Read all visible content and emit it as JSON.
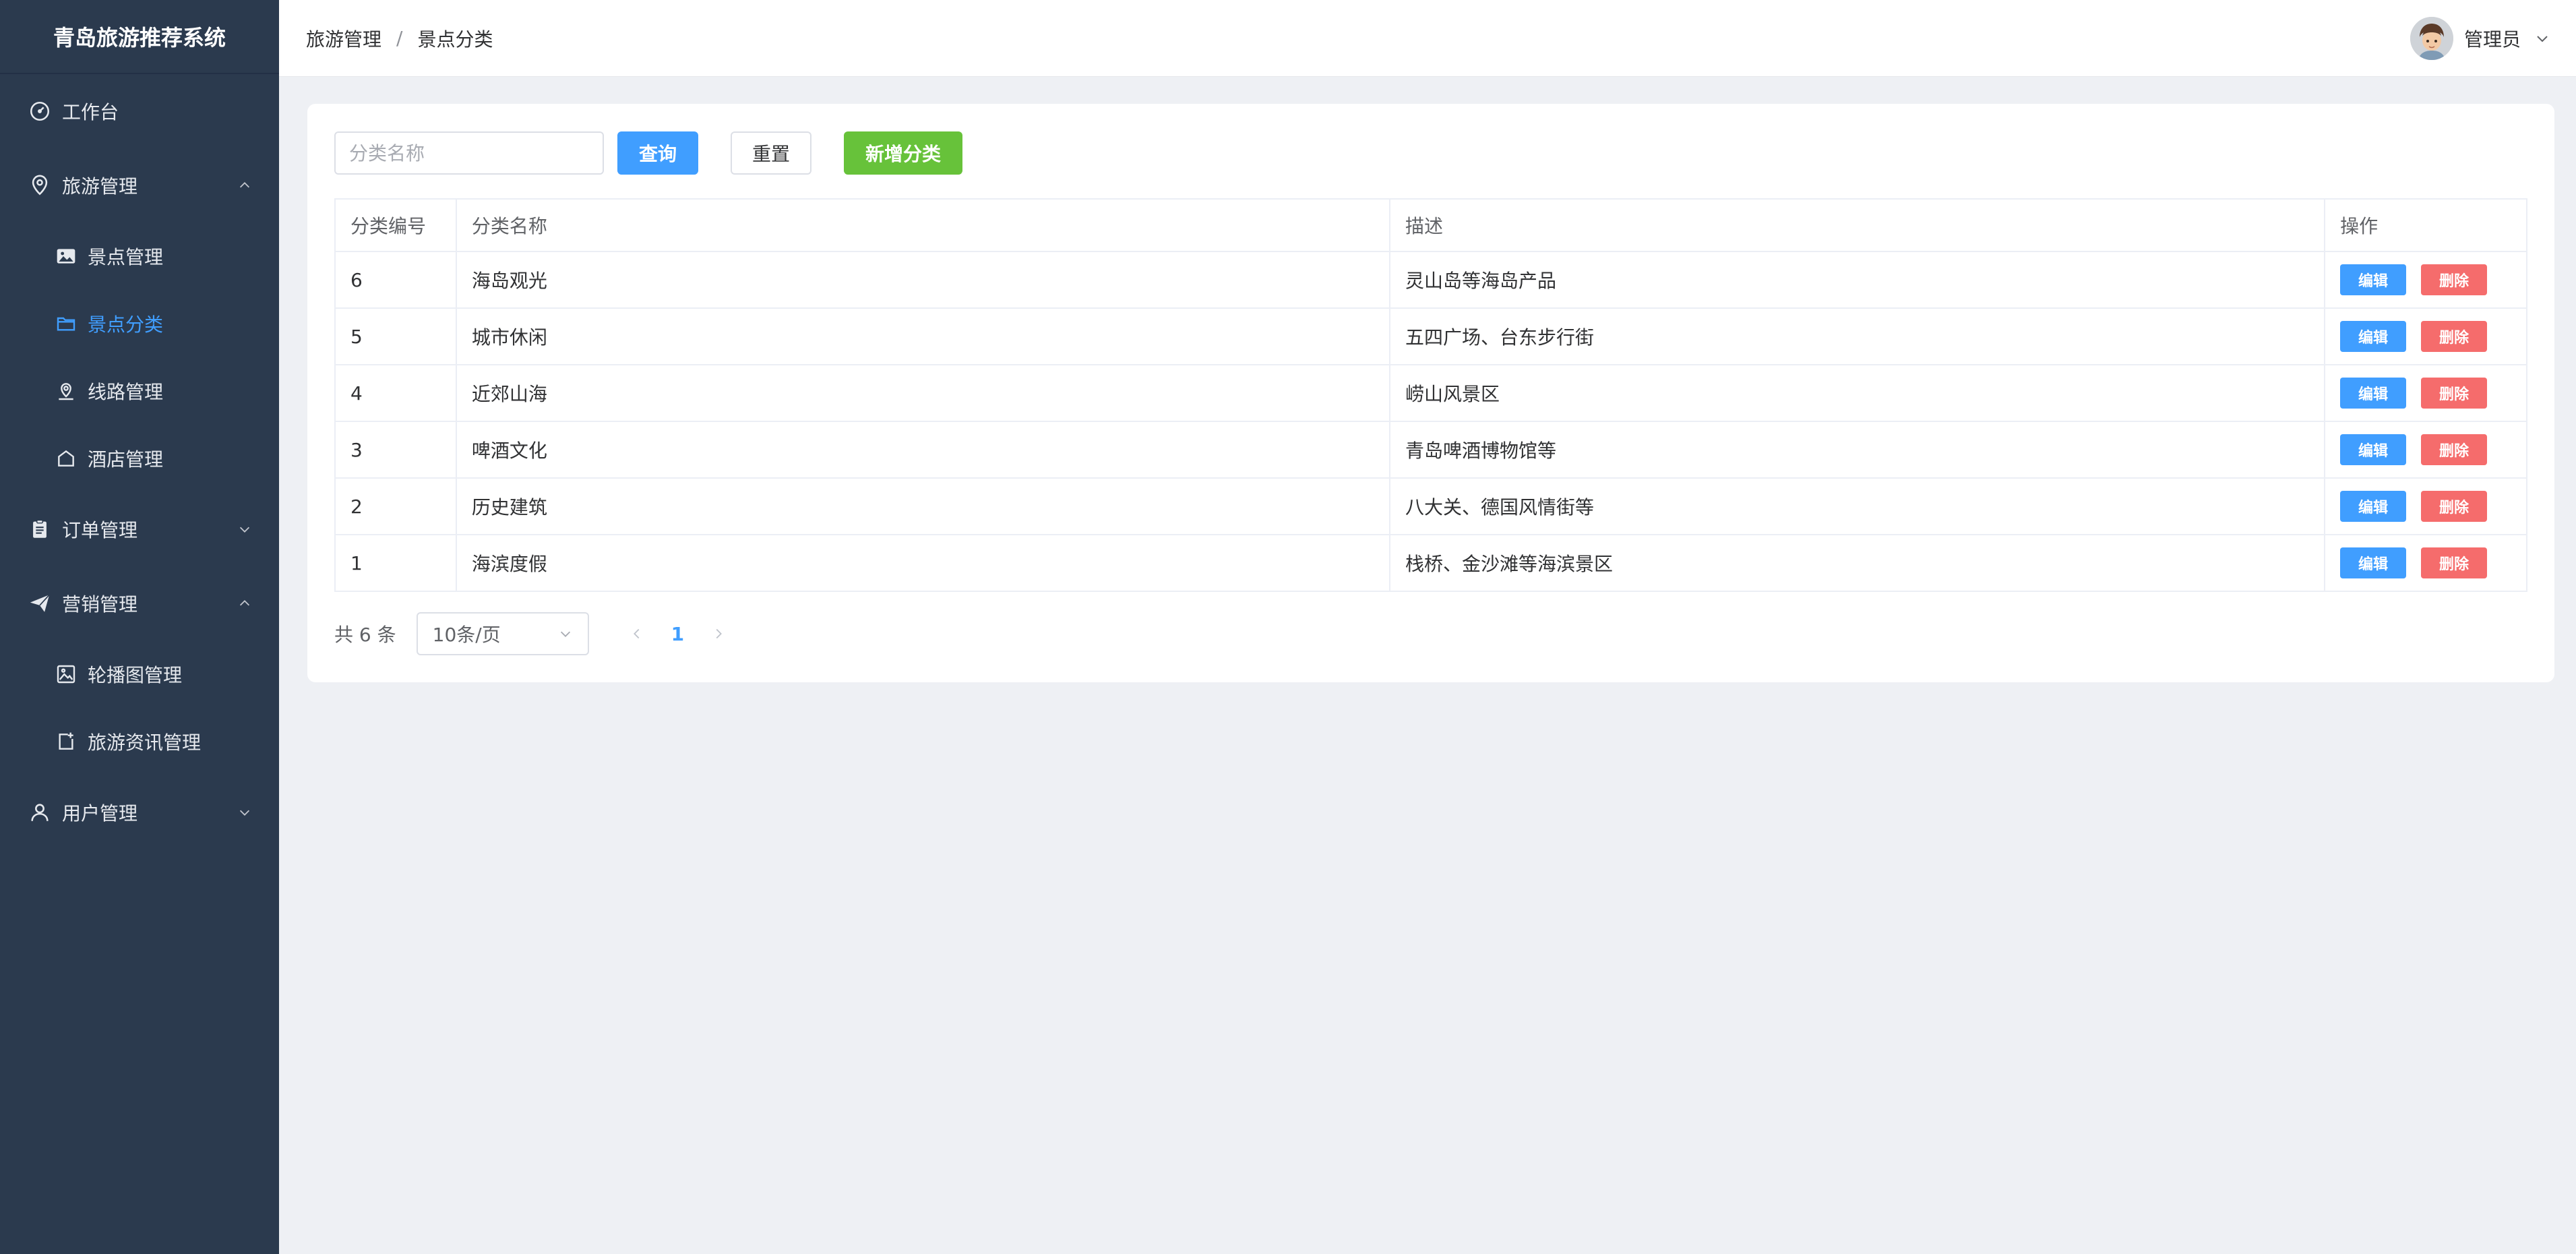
{
  "app": {
    "title": "青岛旅游推荐系统"
  },
  "sidebar": {
    "items": [
      {
        "label": "工作台",
        "icon": "dashboard-icon"
      },
      {
        "label": "旅游管理",
        "icon": "location-pin-icon",
        "expanded": true,
        "children": [
          {
            "label": "景点管理",
            "icon": "picture-icon"
          },
          {
            "label": "景点分类",
            "icon": "folder-icon",
            "active": true
          },
          {
            "label": "线路管理",
            "icon": "map-location-icon"
          },
          {
            "label": "酒店管理",
            "icon": "house-icon"
          }
        ]
      },
      {
        "label": "订单管理",
        "icon": "clipboard-icon",
        "expanded": false
      },
      {
        "label": "营销管理",
        "icon": "paper-plane-icon",
        "expanded": true,
        "children": [
          {
            "label": "轮播图管理",
            "icon": "image-frame-icon"
          },
          {
            "label": "旅游资讯管理",
            "icon": "document-add-icon"
          }
        ]
      },
      {
        "label": "用户管理",
        "icon": "user-icon",
        "expanded": false
      }
    ]
  },
  "header": {
    "breadcrumb": [
      "旅游管理",
      "景点分类"
    ],
    "breadcrumb_sep": "/",
    "user_name": "管理员"
  },
  "toolbar": {
    "search_placeholder": "分类名称",
    "search_value": "",
    "query_label": "查询",
    "reset_label": "重置",
    "add_label": "新增分类"
  },
  "table": {
    "columns": [
      "分类编号",
      "分类名称",
      "描述",
      "操作"
    ],
    "rows": [
      {
        "id": "6",
        "name": "海岛观光",
        "desc": "灵山岛等海岛产品"
      },
      {
        "id": "5",
        "name": "城市休闲",
        "desc": "五四广场、台东步行街"
      },
      {
        "id": "4",
        "name": "近郊山海",
        "desc": "崂山风景区"
      },
      {
        "id": "3",
        "name": "啤酒文化",
        "desc": "青岛啤酒博物馆等"
      },
      {
        "id": "2",
        "name": "历史建筑",
        "desc": "八大关、德国风情街等"
      },
      {
        "id": "1",
        "name": "海滨度假",
        "desc": "栈桥、金沙滩等海滨景区"
      }
    ],
    "edit_label": "编辑",
    "delete_label": "删除"
  },
  "pagination": {
    "total_text": "共 6 条",
    "page_size": "10条/页",
    "current_page": "1"
  },
  "colors": {
    "sidebar_bg": "#2b3a4e",
    "accent": "#409eff",
    "success": "#67c23a",
    "danger": "#f56c6c"
  }
}
